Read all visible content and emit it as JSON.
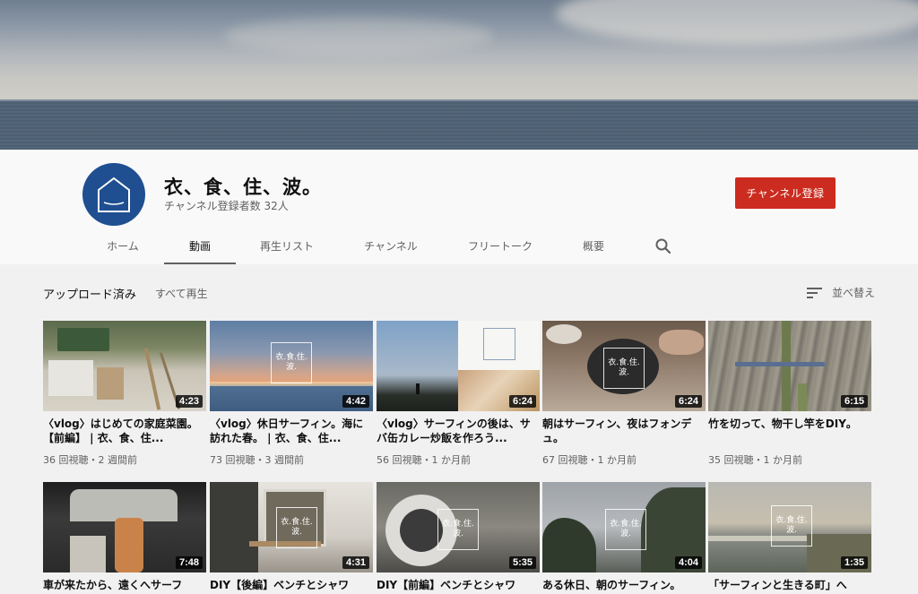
{
  "channel": {
    "name": "衣、食、住、波。",
    "subscribers": "チャンネル登録者数 32人",
    "subscribe_label": "チャンネル登録"
  },
  "tabs": [
    {
      "label": "ホーム"
    },
    {
      "label": "動画"
    },
    {
      "label": "再生リスト"
    },
    {
      "label": "チャンネル"
    },
    {
      "label": "フリートーク"
    },
    {
      "label": "概要"
    }
  ],
  "section": {
    "title": "アップロード済み",
    "play_all": "すべて再生",
    "sort_label": "並べ替え"
  },
  "videos": [
    {
      "title": "〈vlog〉はじめての家庭菜園。【前編】 | 衣、食、住...",
      "meta": "36 回視聴・2 週間前",
      "duration": "4:23"
    },
    {
      "title": "〈vlog〉休日サーフィン。海に訪れた春。 | 衣、食、住...",
      "meta": "73 回視聴・3 週間前",
      "duration": "4:42"
    },
    {
      "title": "〈vlog〉サーフィンの後は、サバ缶カレー炒飯を作ろう...",
      "meta": "56 回視聴・1 か月前",
      "duration": "6:24"
    },
    {
      "title": "朝はサーフィン、夜はフォンデュ。",
      "meta": "67 回視聴・1 か月前",
      "duration": "6:24"
    },
    {
      "title": "竹を切って、物干し竿をDIY。",
      "meta": "35 回視聴・1 か月前",
      "duration": "6:15"
    },
    {
      "title": "車が来たから、遠くへサーフ",
      "meta": "",
      "duration": "7:48"
    },
    {
      "title": "DIY【後編】ベンチとシャワ",
      "meta": "",
      "duration": "4:31"
    },
    {
      "title": "DIY【前編】ベンチとシャワ",
      "meta": "",
      "duration": "5:35"
    },
    {
      "title": "ある休日、朝のサーフィン。",
      "meta": "",
      "duration": "4:04"
    },
    {
      "title": "「サーフィンと生きる町」へ",
      "meta": "",
      "duration": "1:35"
    }
  ],
  "thumb_logo_text": "衣.食.住.波."
}
